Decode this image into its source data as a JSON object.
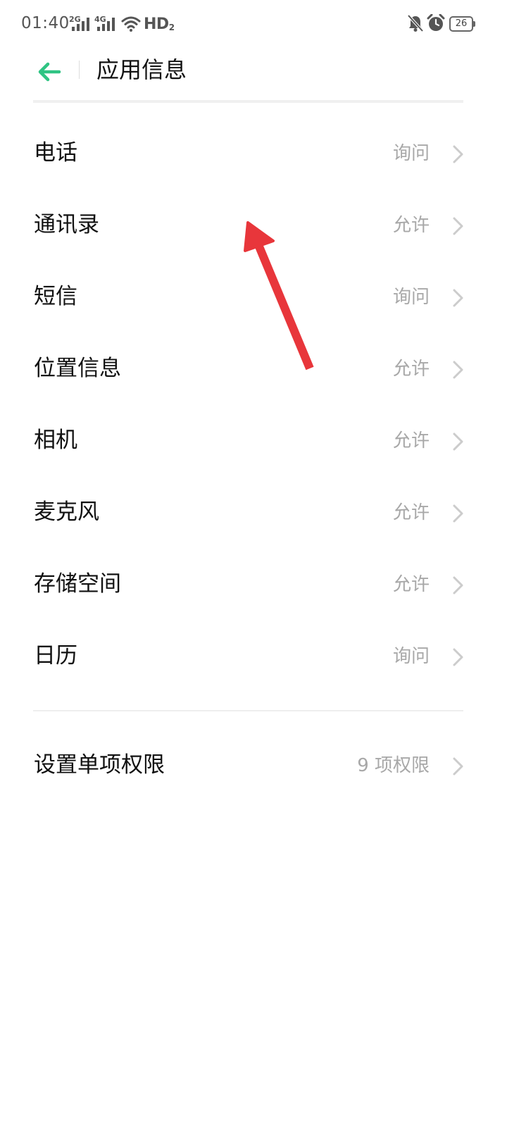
{
  "status_bar": {
    "time": "01:40",
    "signal1_gen": "2G",
    "signal2_gen": "4G",
    "hd_label": "HD",
    "hd_sub": "2",
    "battery": "26"
  },
  "header": {
    "title": "应用信息"
  },
  "permissions": [
    {
      "label": "电话",
      "value": "询问"
    },
    {
      "label": "通讯录",
      "value": "允许"
    },
    {
      "label": "短信",
      "value": "询问"
    },
    {
      "label": "位置信息",
      "value": "允许"
    },
    {
      "label": "相机",
      "value": "允许"
    },
    {
      "label": "麦克风",
      "value": "允许"
    },
    {
      "label": "存储空间",
      "value": "允许"
    },
    {
      "label": "日历",
      "value": "询问"
    }
  ],
  "single_permission": {
    "label": "设置单项权限",
    "value": "9 项权限"
  },
  "colors": {
    "accent": "#2fc483",
    "annotation_arrow": "#e8363b"
  }
}
